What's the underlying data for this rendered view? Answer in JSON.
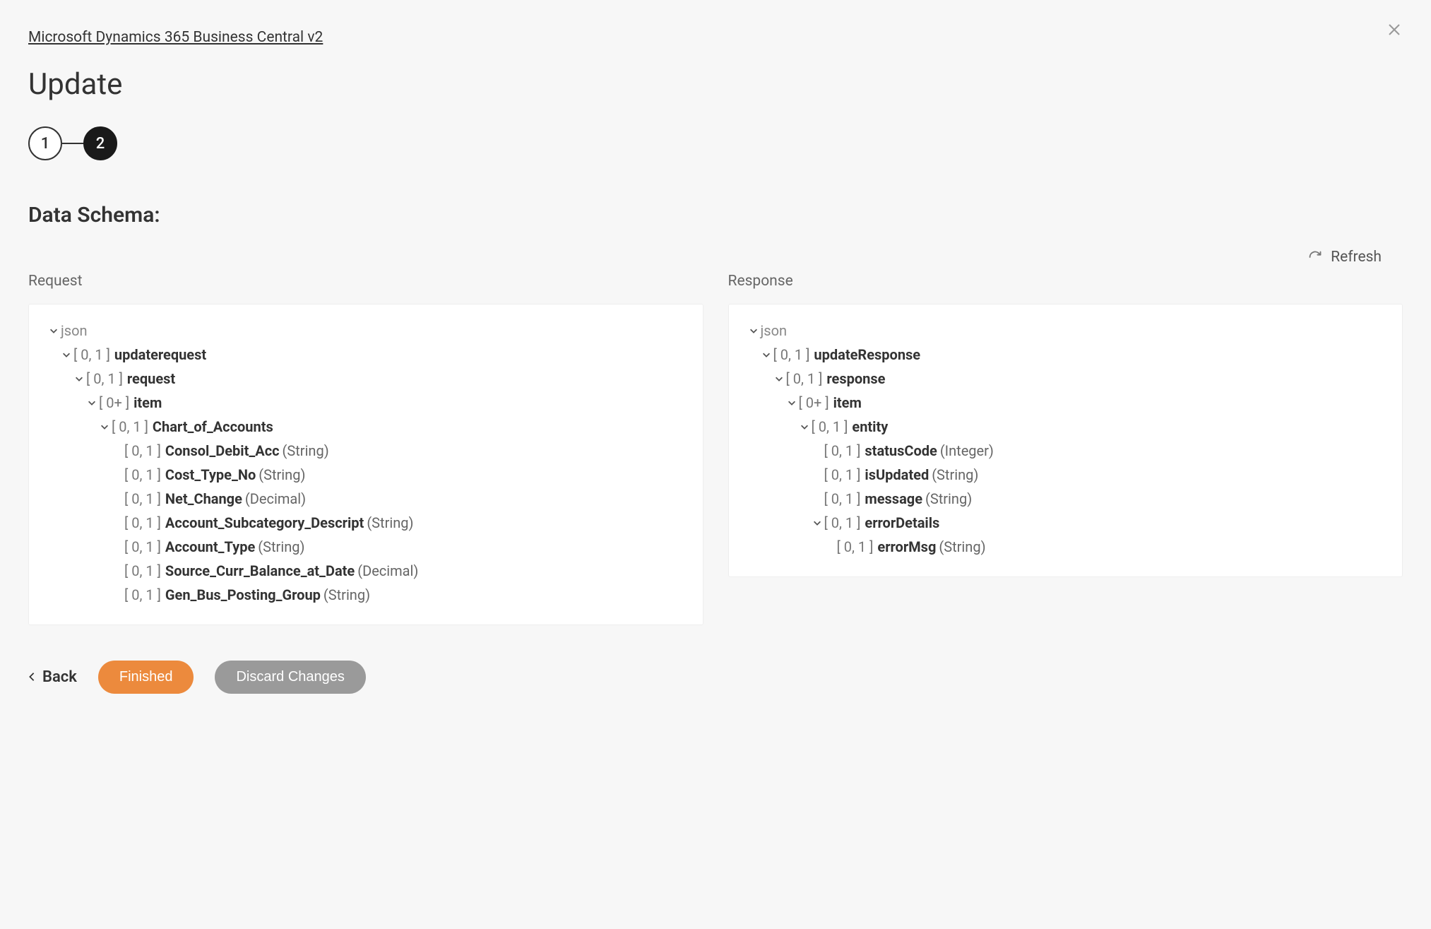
{
  "breadcrumb": "Microsoft Dynamics 365 Business Central v2",
  "page_title": "Update",
  "stepper": {
    "s1": "1",
    "s2": "2"
  },
  "section_title": "Data Schema:",
  "refresh_label": "Refresh",
  "request_label": "Request",
  "response_label": "Response",
  "footer": {
    "back": "Back",
    "finished": "Finished",
    "discard": "Discard Changes"
  },
  "request_tree": [
    {
      "level": 0,
      "chevron": true,
      "card": "",
      "name": "json",
      "type": "",
      "root": true
    },
    {
      "level": 1,
      "chevron": true,
      "card": "[ 0, 1 ]",
      "name": "updaterequest",
      "type": ""
    },
    {
      "level": 2,
      "chevron": true,
      "card": "[ 0, 1 ]",
      "name": "request",
      "type": ""
    },
    {
      "level": 3,
      "chevron": true,
      "card": "[ 0+ ]",
      "name": "item",
      "type": ""
    },
    {
      "level": 4,
      "chevron": true,
      "card": "[ 0, 1 ]",
      "name": "Chart_of_Accounts",
      "type": ""
    },
    {
      "level": 5,
      "chevron": false,
      "card": "[ 0, 1 ]",
      "name": "Consol_Debit_Acc",
      "type": "(String)"
    },
    {
      "level": 5,
      "chevron": false,
      "card": "[ 0, 1 ]",
      "name": "Cost_Type_No",
      "type": "(String)"
    },
    {
      "level": 5,
      "chevron": false,
      "card": "[ 0, 1 ]",
      "name": "Net_Change",
      "type": "(Decimal)"
    },
    {
      "level": 5,
      "chevron": false,
      "card": "[ 0, 1 ]",
      "name": "Account_Subcategory_Descript",
      "type": "(String)"
    },
    {
      "level": 5,
      "chevron": false,
      "card": "[ 0, 1 ]",
      "name": "Account_Type",
      "type": "(String)"
    },
    {
      "level": 5,
      "chevron": false,
      "card": "[ 0, 1 ]",
      "name": "Source_Curr_Balance_at_Date",
      "type": "(Decimal)"
    },
    {
      "level": 5,
      "chevron": false,
      "card": "[ 0, 1 ]",
      "name": "Gen_Bus_Posting_Group",
      "type": "(String)"
    }
  ],
  "response_tree": [
    {
      "level": 0,
      "chevron": true,
      "card": "",
      "name": "json",
      "type": "",
      "root": true
    },
    {
      "level": 1,
      "chevron": true,
      "card": "[ 0, 1 ]",
      "name": "updateResponse",
      "type": ""
    },
    {
      "level": 2,
      "chevron": true,
      "card": "[ 0, 1 ]",
      "name": "response",
      "type": ""
    },
    {
      "level": 3,
      "chevron": true,
      "card": "[ 0+ ]",
      "name": "item",
      "type": ""
    },
    {
      "level": 4,
      "chevron": true,
      "card": "[ 0, 1 ]",
      "name": "entity",
      "type": ""
    },
    {
      "level": 5,
      "chevron": false,
      "card": "[ 0, 1 ]",
      "name": "statusCode",
      "type": "(Integer)"
    },
    {
      "level": 5,
      "chevron": false,
      "card": "[ 0, 1 ]",
      "name": "isUpdated",
      "type": "(String)"
    },
    {
      "level": 5,
      "chevron": false,
      "card": "[ 0, 1 ]",
      "name": "message",
      "type": "(String)"
    },
    {
      "level": 5,
      "chevron": true,
      "card": "[ 0, 1 ]",
      "name": "errorDetails",
      "type": ""
    },
    {
      "level": 6,
      "chevron": false,
      "card": "[ 0, 1 ]",
      "name": "errorMsg",
      "type": "(String)"
    }
  ]
}
